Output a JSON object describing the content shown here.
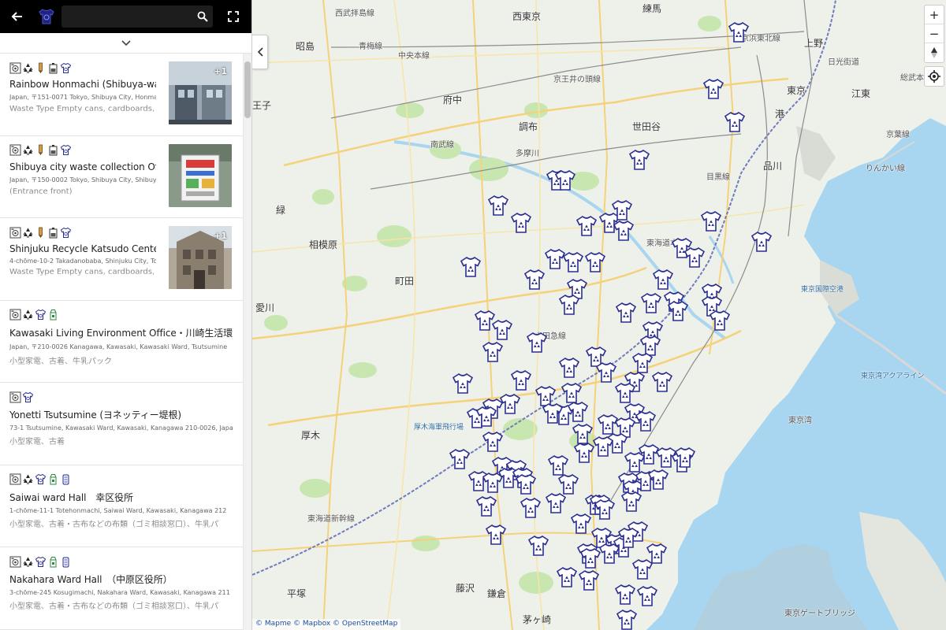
{
  "sidebar": {
    "search": {
      "placeholder": "",
      "value": ""
    },
    "listings": [
      {
        "name": "Rainbow Honmachi (Shibuya-ward",
        "address": "Japan, 〒151-0071 Tokyo, Shibuya City, Honmachi",
        "desc": "Waste Type    Empty cans, cardboards,",
        "thumb_count": "+1",
        "icons": [
          "appliance-icon",
          "recycle-icon",
          "pen-icon",
          "battery-icon",
          "shirt-icon"
        ]
      },
      {
        "name": "Shibuya city waste collection Offi",
        "address": "Japan, 〒150-0002 Tokyo, Shibuya City, Shibuya",
        "desc": "(Entrance front)",
        "thumb_count": "",
        "icons": [
          "appliance-icon",
          "recycle-icon",
          "pen-icon",
          "battery-icon",
          "shirt-icon"
        ]
      },
      {
        "name": "Shinjuku Recycle Katsudo Center",
        "address": "4-chōme-10-2 Takadanobaba, Shinjuku City, Tokyo",
        "desc": "Waste Type    Empty cans, cardboards,",
        "thumb_count": "+1",
        "icons": [
          "appliance-icon",
          "recycle-icon",
          "pen-icon",
          "battery-icon",
          "shirt-icon"
        ]
      },
      {
        "name": "Kawasaki Living Environment Office・川崎生活環",
        "address": "Japan, 〒210-0026 Kanagawa, Kawasaki, Kawasaki Ward, Tsutsumine",
        "desc": "小型家電、古着、牛乳パック",
        "thumb_count": "",
        "icons": [
          "appliance-icon",
          "recycle-icon",
          "shirt-icon",
          "milk-carton-icon"
        ]
      },
      {
        "name": "Yonetti Tsutsumine (ヨネッティー堤根)",
        "address": "73-1 Tsutsumine, Kawasaki Ward, Kawasaki, Kanagawa 210-0026, Japan",
        "desc": "小型家電、古着",
        "thumb_count": "",
        "icons": [
          "appliance-icon",
          "shirt-icon"
        ]
      },
      {
        "name": "Saiwai ward Hall　幸区役所",
        "address": "1-chōme-11-1 Totehonmachi, Saiwai Ward, Kawasaki, Kanagawa 212",
        "desc": "小型家電、古着・古布などの布類（ゴミ相談窓口）、牛乳パ",
        "thumb_count": "",
        "icons": [
          "appliance-icon",
          "recycle-icon",
          "shirt-icon",
          "milk-carton-icon",
          "bottle-icon"
        ]
      },
      {
        "name": "Nakahara Ward Hall　（中原区役所）",
        "address": "3-chōme-245 Kosugimachi, Nakahara Ward, Kawasaki, Kanagawa 211",
        "desc": "小型家電、古着・古布などの布類（ゴミ相談窓口）、牛乳パ",
        "thumb_count": "",
        "icons": [
          "appliance-icon",
          "recycle-icon",
          "shirt-icon",
          "milk-carton-icon",
          "bottle-icon"
        ]
      }
    ]
  },
  "map": {
    "places": [
      "練馬",
      "西武拝島線",
      "西東京",
      "昭島",
      "青梅線",
      "中央本線",
      "王子",
      "府中",
      "京王井の頭線",
      "調布",
      "世田谷",
      "目黒線",
      "品川",
      "東京",
      "上野",
      "江東",
      "港",
      "町田",
      "相模原",
      "緑",
      "愛川",
      "厚木",
      "平塚",
      "藤沢",
      "鎌倉",
      "茅ヶ崎",
      "厚木海軍飛行場",
      "東京国際空港",
      "東京湾",
      "りんかい線",
      "京葉線",
      "小田急線",
      "東海道新幹線",
      "南武線",
      "総武本線",
      "多摩川",
      "日光街道",
      "東京湾アクアライン",
      "東海道本線",
      "京浜東北線",
      "東京ゲートブリッジ"
    ],
    "attribution": [
      "© Mapme",
      "© Mapbox",
      "© OpenStreetMap"
    ],
    "controls": {
      "zoom_in": "+",
      "zoom_out": "−",
      "compass": "▲"
    },
    "colors": {
      "water": "#a8d5ef",
      "land": "#eef0ea",
      "park": "#c8e6b0",
      "marker": "#2a2f8f"
    }
  }
}
